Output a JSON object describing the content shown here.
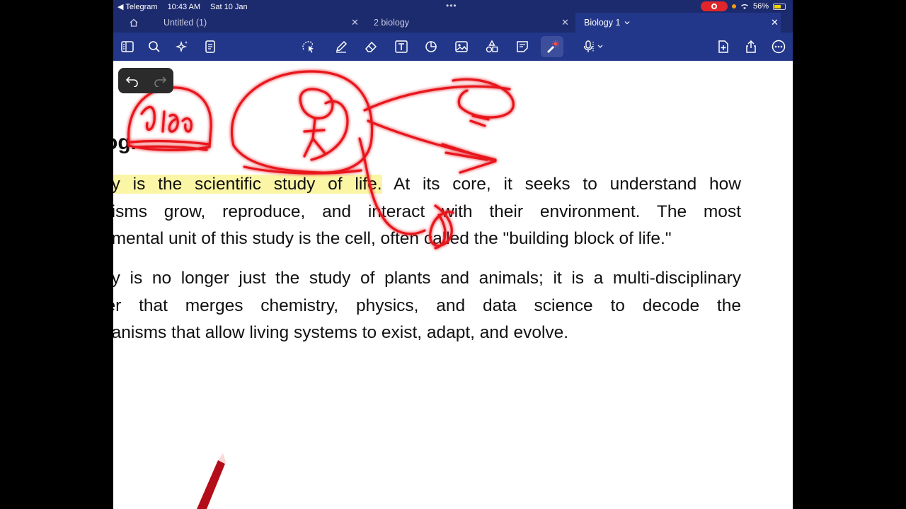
{
  "status": {
    "back_app": "◀ Telegram",
    "time": "10:43 AM",
    "date": "Sat 10 Jan",
    "battery": "56%"
  },
  "tabs": [
    {
      "label": "Untitled (1)"
    },
    {
      "label": "2 biology"
    },
    {
      "label": "Biology 1"
    }
  ],
  "document": {
    "heading": "og.",
    "para1": [
      {
        "hl": "gy is the scientific study of life.",
        "text": " At its core, it seeks to understand how"
      },
      {
        "text": "nisms grow, reproduce, and interact with their environment. The most"
      },
      {
        "text": "amental unit of this study is the cell, often called the \"building block of life.\""
      }
    ],
    "para2": [
      "gy is no longer just the study of plants and animals; it is a multi-disciplinary",
      "ier that merges chemistry, physics, and data science to decode the",
      "hanisms that allow living systems to exist, adapt, and evolve."
    ]
  },
  "colors": {
    "chrome": "#23378a",
    "statusbar": "#1c2a6e",
    "ink": "#e8141f",
    "highlight": "#fbf6a5"
  },
  "icons": {
    "toolbar": [
      "sidebar-icon",
      "search-icon",
      "ai-sparkle-icon",
      "outline-icon",
      "lasso-icon",
      "pen-icon",
      "eraser-icon",
      "text-icon",
      "shapes-icon",
      "image-icon",
      "sticker-icon",
      "sticky-note-icon",
      "laser-pointer-icon",
      "microphone-icon",
      "add-page-icon",
      "share-icon",
      "more-icon"
    ]
  }
}
